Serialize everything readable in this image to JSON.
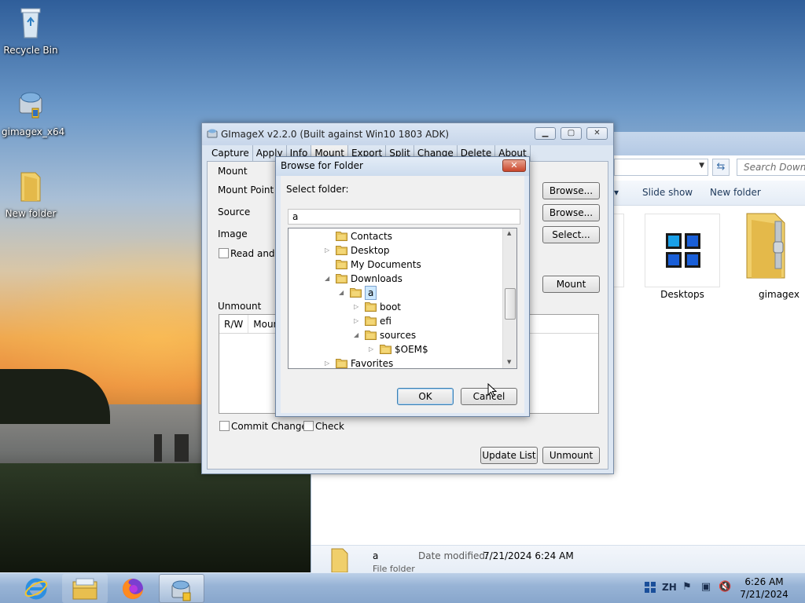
{
  "desktop": {
    "icons": [
      {
        "label": "Recycle Bin",
        "icon": "recycle-bin-icon"
      },
      {
        "label": "gimagex_x64",
        "icon": "gimagex-icon"
      },
      {
        "label": "New folder",
        "icon": "folder-icon"
      }
    ]
  },
  "explorer": {
    "search_placeholder": "Search Downlo",
    "commands": [
      "Slide show",
      "New folder"
    ],
    "tiles": [
      {
        "label": "Desktops",
        "icon": "desktops-app-icon"
      },
      {
        "label": "gimagex",
        "icon": "zip-folder-icon"
      }
    ],
    "details": {
      "name": "a",
      "modified_label": "Date modified:",
      "modified_value": "7/21/2024 6:24 AM",
      "type": "File folder"
    }
  },
  "gimagex": {
    "title": "GImageX v2.2.0 (Built against Win10 1803 ADK)",
    "tabs": [
      "Capture",
      "Apply",
      "Info",
      "Mount",
      "Export",
      "Split",
      "Change",
      "Delete",
      "About"
    ],
    "mount_group": "Mount",
    "labels": {
      "mount_point": "Mount Point",
      "source": "Source",
      "image": "Image",
      "read_write": "Read and W"
    },
    "buttons": {
      "browse1": "Browse...",
      "browse2": "Browse...",
      "select": "Select...",
      "mount": "Mount",
      "update_list": "Update List",
      "unmount": "Unmount"
    },
    "unmount_group": "Unmount",
    "list_columns": [
      "R/W",
      "Mount"
    ],
    "commit_changes": "Commit Changes",
    "check": "Check"
  },
  "dialog": {
    "title": "Browse for Folder",
    "close_label": "✕",
    "prompt": "Select folder:",
    "path_value": "a",
    "tree": [
      {
        "label": "Contacts",
        "level": 4,
        "arrow": "",
        "icon": "contacts-folder-icon"
      },
      {
        "label": "Desktop",
        "level": 4,
        "arrow": "▷",
        "icon": "desktop-folder-icon"
      },
      {
        "label": "My Documents",
        "level": 4,
        "arrow": "",
        "icon": "documents-folder-icon"
      },
      {
        "label": "Downloads",
        "level": 4,
        "arrow": "◢",
        "icon": "downloads-folder-icon"
      },
      {
        "label": "a",
        "level": 5,
        "arrow": "◢",
        "icon": "folder-icon",
        "selected": true
      },
      {
        "label": "boot",
        "level": 6,
        "arrow": "▷",
        "icon": "folder-icon"
      },
      {
        "label": "efi",
        "level": 6,
        "arrow": "▷",
        "icon": "folder-icon"
      },
      {
        "label": "sources",
        "level": 6,
        "arrow": "◢",
        "icon": "folder-icon"
      },
      {
        "label": "$OEM$",
        "level": 7,
        "arrow": "▷",
        "icon": "folder-icon"
      },
      {
        "label": "Favorites",
        "level": 4,
        "arrow": "▷",
        "icon": "favorites-folder-icon"
      }
    ],
    "ok": "OK",
    "cancel": "Cancel"
  },
  "taskbar": {
    "apps": [
      {
        "name": "internet-explorer",
        "icon": "internet-explorer-icon"
      },
      {
        "name": "file-explorer",
        "icon": "file-explorer-icon"
      },
      {
        "name": "firefox",
        "icon": "firefox-icon"
      },
      {
        "name": "gimagex",
        "icon": "gimagex-icon",
        "active": true
      }
    ],
    "tray": {
      "ime": "ZH"
    },
    "time": "6:26 AM",
    "date": "7/21/2024"
  },
  "colors": {
    "selection": "#cce8ff",
    "folder": "#e8c45a",
    "accent": "#3a6ea8"
  }
}
